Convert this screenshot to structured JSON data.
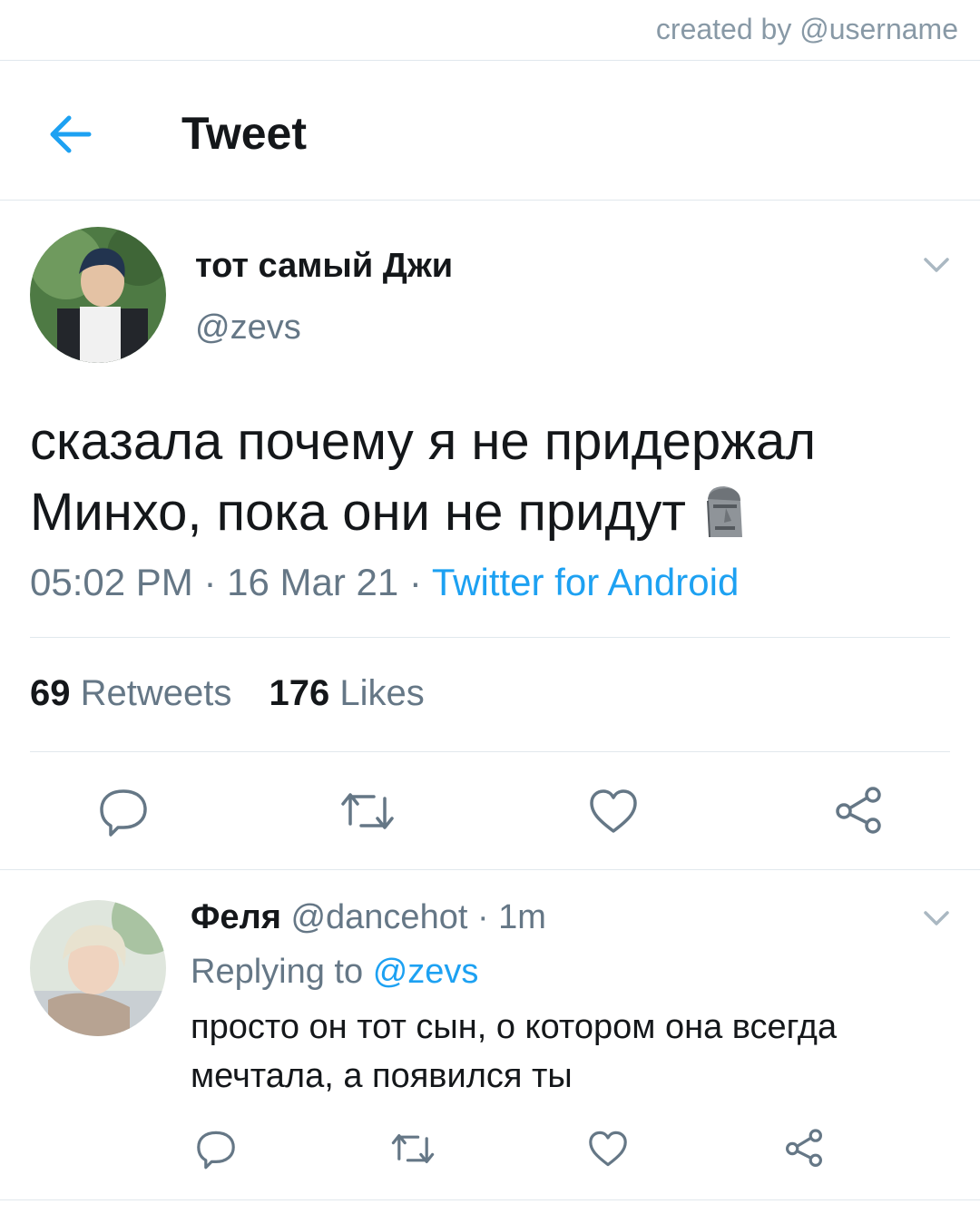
{
  "credit": "created by @username",
  "header": {
    "title": "Tweet",
    "back_icon": "arrow-left-icon"
  },
  "tweet": {
    "author_name": "тот самый Джи",
    "author_handle": "@zevs",
    "text": "сказала почему я не придержал Минхо, пока они не придут",
    "emoji": "moai",
    "time": "05:02 PM",
    "date": "16 Mar 21",
    "source": "Twitter for Android",
    "sep": "·",
    "retweets_count": "69",
    "retweets_label": "Retweets",
    "likes_count": "176",
    "likes_label": "Likes"
  },
  "reply": {
    "author_name": "Феля",
    "author_handle": "@dancehot",
    "sep": "·",
    "age": "1m",
    "replying_label": "Replying to",
    "replying_to": "@zevs",
    "text": "просто он тот сын, о котором она всегда мечтала, а появился ты"
  },
  "colors": {
    "accent": "#1da1f2",
    "muted": "#657786",
    "icon": "#657786",
    "divider": "#e1e8ed"
  },
  "actions": [
    "reply",
    "retweet",
    "like",
    "share"
  ]
}
